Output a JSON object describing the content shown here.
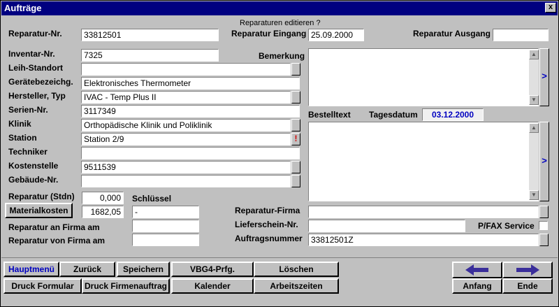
{
  "window": {
    "title": "Aufträge",
    "close": "x"
  },
  "header_note": "Reparaturen editieren ?",
  "reparatur": {
    "nr_label": "Reparatur-Nr.",
    "nr_value": "33812501",
    "eingang_label": "Reparatur Eingang",
    "eingang_value": "25.09.2000",
    "ausgang_label": "Reparatur Ausgang",
    "ausgang_value": ""
  },
  "left_fields": [
    {
      "label": "Inventar-Nr.",
      "value": " 7325"
    },
    {
      "label": "Leih-Standort",
      "value": ""
    },
    {
      "label": "Gerätebezeichg.",
      "value": "Elektronisches Thermometer"
    },
    {
      "label": "Hersteller, Typ",
      "value": "IVAC - Temp Plus II"
    },
    {
      "label": "Serien-Nr.",
      "value": "3117349"
    },
    {
      "label": "Klinik",
      "value": "Orthopädische Klinik und Poliklinik"
    },
    {
      "label": "Station",
      "value": "Station 2/9"
    },
    {
      "label": "Techniker",
      "value": ""
    },
    {
      "label": "Kostenstelle",
      "value": "9511539"
    },
    {
      "label": "Gebäude-Nr.",
      "value": ""
    }
  ],
  "station_alert": "!",
  "bemerkung_label": "Bemerkung",
  "bemerkung_value": "",
  "bestelltext_label": "Bestelltext",
  "tagesdatum_label": "Tagesdatum",
  "tagesdatum_value": "03.12.2000",
  "bestelltext_value": "",
  "side_arrow": ">",
  "kosten": {
    "stunden_label": "Reparatur (Stdn)",
    "stunden_value": "0,000",
    "material_button": "Materialkosten",
    "material_value": "1682,05",
    "schluessel_label": "Schlüssel",
    "schluessel_value": "-"
  },
  "firma": {
    "an_label": "Reparatur an Firma am",
    "an_value": "",
    "von_label": "Reparatur von Firma am",
    "von_value": "",
    "firma_label": "Reparatur-Firma",
    "firma_value": "",
    "liefer_label": "Lieferschein-Nr.",
    "liefer_value": "",
    "pfax_label": "P/FAX Service",
    "auftrag_label": "Auftragsnummer",
    "auftrag_value": "33812501Z"
  },
  "buttons": {
    "hauptmenu": "Hauptmenü",
    "zurueck": "Zurück",
    "speichern": "Speichern",
    "vbg4": "VBG4-Prfg.",
    "loeschen": "Löschen",
    "druck_formular": "Druck Formular",
    "druck_firmenauftrag": "Druck Firmenauftrag",
    "kalender": "Kalender",
    "arbeitszeiten": "Arbeitszeiten",
    "anfang": "Anfang",
    "ende": "Ende"
  },
  "icons": {
    "back": "arrow-left-icon",
    "forward": "arrow-right-icon"
  },
  "colors": {
    "titlebar": "#000080",
    "accent_text": "#0000c0",
    "arrow": "#3a2e9a"
  }
}
